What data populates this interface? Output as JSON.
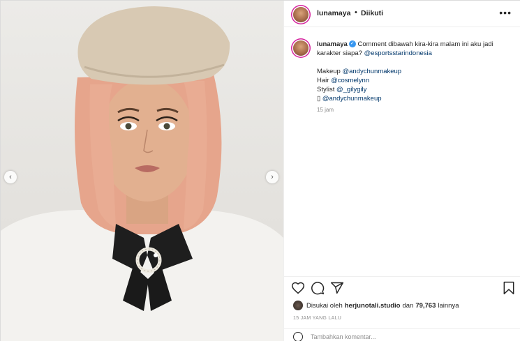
{
  "header": {
    "username": "lunamaya",
    "separator": "•",
    "follow_status": "Diikuti",
    "more_icon": "•••"
  },
  "caption": {
    "username": "lunamaya",
    "text_part1": "Comment dibawah kira-kira malam ini aku jadi karakter siapa?",
    "mention_1": "@esportsstarindonesia",
    "makeup_label": "Makeup",
    "makeup_mention": "@andychunmakeup",
    "hair_label": "Hair",
    "hair_mention": "@cosmelynn",
    "stylist_label": "Stylist",
    "stylist_mention": "@_gilygily",
    "box_char": "▯",
    "extra_mention": "@andychunmakeup",
    "time": "15 jam"
  },
  "carousel": {
    "prev_icon": "‹",
    "next_icon": "›"
  },
  "likes": {
    "prefix": "Disukai oleh",
    "user": "herjunotali.studio",
    "and": "dan",
    "count": "79,763",
    "suffix": "lainnya"
  },
  "timestamp": "15 JAM YANG LALU",
  "comment_placeholder": "Tambahkan komentar...",
  "colors": {
    "accent": "#3897f0",
    "mention": "#00376b",
    "muted": "#8e8e8e",
    "hair": "#e8a98f",
    "beret": "#d9cbb6",
    "shirt": "#f4f3f0",
    "bow": "#1c1c1c"
  }
}
